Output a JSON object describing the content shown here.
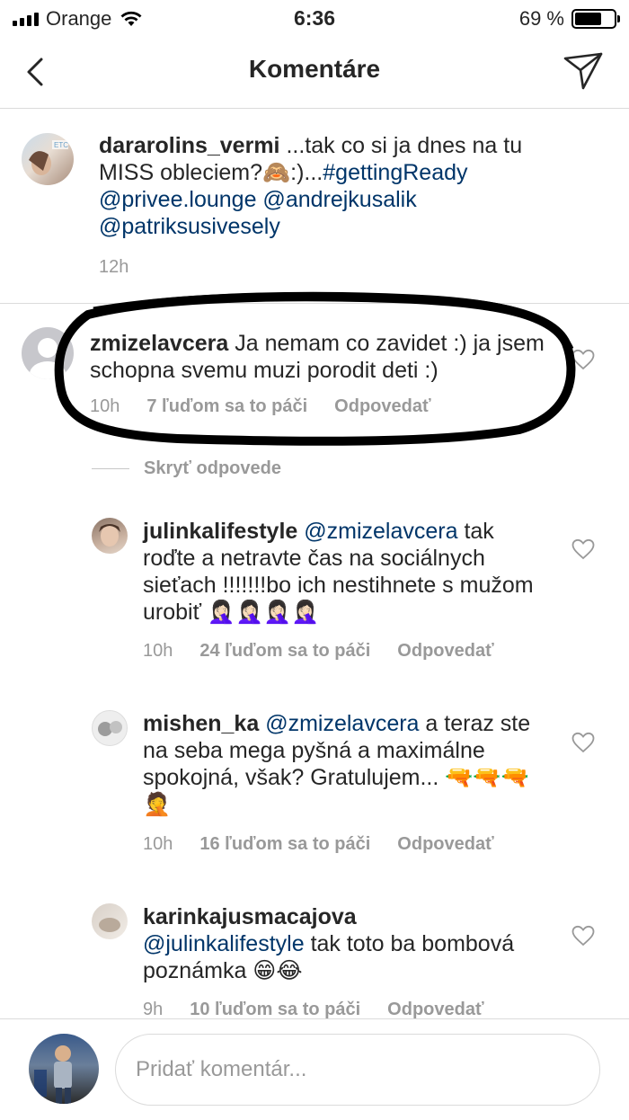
{
  "status_bar": {
    "carrier": "Orange",
    "time": "6:36",
    "battery": "69 %",
    "battery_level": 0.69
  },
  "header": {
    "title": "Komentáre"
  },
  "caption": {
    "username": "dararolins_vermi",
    "text_1": " ...tak co si ja dnes na tu MISS obleciem?🙈:)...",
    "hashtag": "#gettingReady",
    "mentions": "@privee.lounge @andrejkusalik @patriksusivesely",
    "time": "12h"
  },
  "comments": [
    {
      "username": "zmizelavcera",
      "mention": "",
      "text": " Ja nemam co zavidet :) ja jsem schopna svemu muzi porodit deti :)",
      "time": "10h",
      "likes": "7 ľuďom sa to páči",
      "reply": "Odpovedať"
    },
    {
      "username": "julinkalifestyle",
      "mention": "@zmizelavcera",
      "text": " tak roďte a netravte čas na sociálnych sieťach !!!!!!!bo ich nestihnete s mužom urobiť 🤦🏻‍♀️🤦🏻‍♀️🤦🏻‍♀️🤦🏻‍♀️",
      "time": "10h",
      "likes": "24 ľuďom sa to páči",
      "reply": "Odpovedať"
    },
    {
      "username": "mishen_ka",
      "mention": "@zmizelavcera",
      "text": " a teraz ste na seba mega pyšná a maximálne spokojná, však? Gratulujem... 🔫🔫🔫🤦",
      "time": "10h",
      "likes": "16 ľuďom sa to páči",
      "reply": "Odpovedať"
    },
    {
      "username": "karinkajusmacajova",
      "mention": "@julinkalifestyle",
      "text": " tak toto ba bombová poznámka 😁😂",
      "time": "9h",
      "likes": "10 ľuďom sa to páči",
      "reply": "Odpovedať"
    }
  ],
  "hide_replies": "Skryť odpovede",
  "input": {
    "placeholder": "Pridať komentár..."
  },
  "icons": {
    "back": "chevron-left-icon",
    "send": "paper-plane-icon",
    "like": "heart-outline-icon"
  },
  "colors": {
    "mention": "#003569",
    "meta": "#999999",
    "annotation": "#000000"
  }
}
